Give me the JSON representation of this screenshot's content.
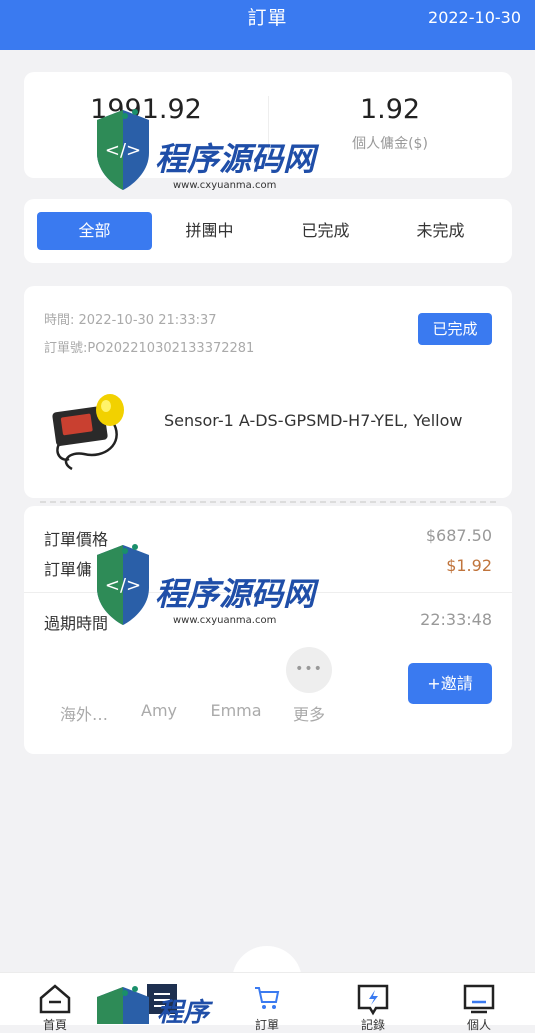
{
  "header": {
    "title": "訂單",
    "date": "2022-10-30"
  },
  "stats": {
    "left_value": "1991.92",
    "right_value": "1.92",
    "right_label": "個人傭金($)"
  },
  "tabs": [
    {
      "label": "全部",
      "active": true
    },
    {
      "label": "拼團中",
      "active": false
    },
    {
      "label": "已完成",
      "active": false
    },
    {
      "label": "未完成",
      "active": false
    }
  ],
  "order": {
    "time": "時間: 2022-10-30 21:33:37",
    "order_no": "訂單號:PO202210302133372281",
    "status": "已完成",
    "product_name": "Sensor-1 A-DS-GPSMD-H7-YEL, Yellow",
    "price_label": "訂單價格",
    "price_value": "$687.50",
    "commission_label": "訂單傭",
    "commission_value": "$1.92",
    "expire_label": "過期時間",
    "expire_value": "22:33:48",
    "members": [
      "海外…",
      "Amy",
      "Emma",
      "更多"
    ],
    "more_dots": "•••",
    "invite": "+邀請"
  },
  "watermark": {
    "text": "程序源码网",
    "url": "www.cxyuanma.com"
  },
  "tabbar": {
    "items": [
      "首頁",
      "",
      "訂單",
      "記錄",
      "個人"
    ]
  },
  "colors": {
    "primary": "#3a7af0",
    "commission": "#c0743c"
  }
}
